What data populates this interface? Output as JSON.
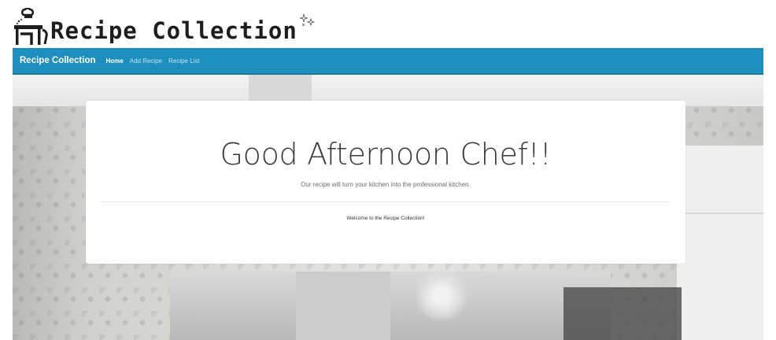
{
  "logo": {
    "text": "Recipe Collection",
    "icon": "chef-cooking-icon",
    "sparkle_icon": "sparkle-icon"
  },
  "navbar": {
    "brand": "Recipe Collection",
    "links": [
      {
        "label": "Home",
        "active": true
      },
      {
        "label": "Add Recipe",
        "active": false
      },
      {
        "label": "Recipe List",
        "active": false
      }
    ],
    "color": "#1d8fbe"
  },
  "hero": {
    "title": "Good Afternoon Chef!!",
    "lead": "Our recipe will turn your kitchen into the professional kitchen.",
    "welcome": "Welcome to the Recipe Collection!"
  }
}
